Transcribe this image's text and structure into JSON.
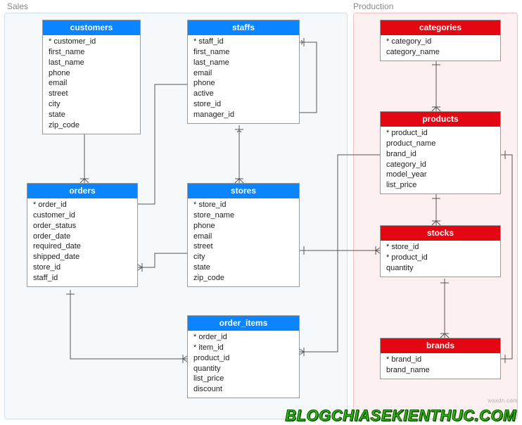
{
  "schemas": {
    "sales": {
      "label": "Sales"
    },
    "production": {
      "label": "Production"
    }
  },
  "entities": {
    "customers": {
      "title": "customers",
      "columns": [
        "* customer_id",
        "first_name",
        "last_name",
        "phone",
        "email",
        "street",
        "city",
        "state",
        "zip_code"
      ]
    },
    "staffs": {
      "title": "staffs",
      "columns": [
        "* staff_id",
        "first_name",
        "last_name",
        "email",
        "phone",
        "active",
        "store_id",
        "manager_id"
      ]
    },
    "orders": {
      "title": "orders",
      "columns": [
        "* order_id",
        "customer_id",
        "order_status",
        "order_date",
        "required_date",
        "shipped_date",
        "store_id",
        "staff_id"
      ]
    },
    "stores": {
      "title": "stores",
      "columns": [
        "* store_id",
        "store_name",
        "phone",
        "email",
        "street",
        "city",
        "state",
        "zip_code"
      ]
    },
    "order_items": {
      "title": "order_items",
      "columns": [
        "* order_id",
        "* item_id",
        "product_id",
        "quantity",
        "list_price",
        "discount"
      ]
    },
    "categories": {
      "title": "categories",
      "columns": [
        "* category_id",
        "category_name"
      ]
    },
    "products": {
      "title": "products",
      "columns": [
        "* product_id",
        "product_name",
        "brand_id",
        "category_id",
        "model_year",
        "list_price"
      ]
    },
    "stocks": {
      "title": "stocks",
      "columns": [
        "* store_id",
        "* product_id",
        "quantity"
      ]
    },
    "brands": {
      "title": "brands",
      "columns": [
        "* brand_id",
        "brand_name"
      ]
    }
  },
  "relationships": [
    {
      "from": "customers.customer_id",
      "to": "orders.customer_id",
      "type": "one-to-many"
    },
    {
      "from": "staffs.manager_id",
      "to": "staffs.staff_id",
      "type": "self-one-to-many"
    },
    {
      "from": "staffs.staff_id",
      "to": "orders.staff_id",
      "type": "one-to-many"
    },
    {
      "from": "staffs.store_id",
      "to": "stores.store_id",
      "type": "many-to-one"
    },
    {
      "from": "stores.store_id",
      "to": "orders.store_id",
      "type": "one-to-many"
    },
    {
      "from": "stores.store_id",
      "to": "stocks.store_id",
      "type": "one-to-many"
    },
    {
      "from": "orders.order_id",
      "to": "order_items.order_id",
      "type": "one-to-many"
    },
    {
      "from": "order_items.product_id",
      "to": "products.product_id",
      "type": "many-to-one"
    },
    {
      "from": "categories.category_id",
      "to": "products.category_id",
      "type": "one-to-many"
    },
    {
      "from": "products.product_id",
      "to": "stocks.product_id",
      "type": "one-to-many"
    },
    {
      "from": "products.brand_id",
      "to": "brands.brand_id",
      "type": "many-to-one"
    }
  ],
  "watermark": "BLOGCHIASEKIENTHUC.COM",
  "source_text": "wsxdn.com"
}
